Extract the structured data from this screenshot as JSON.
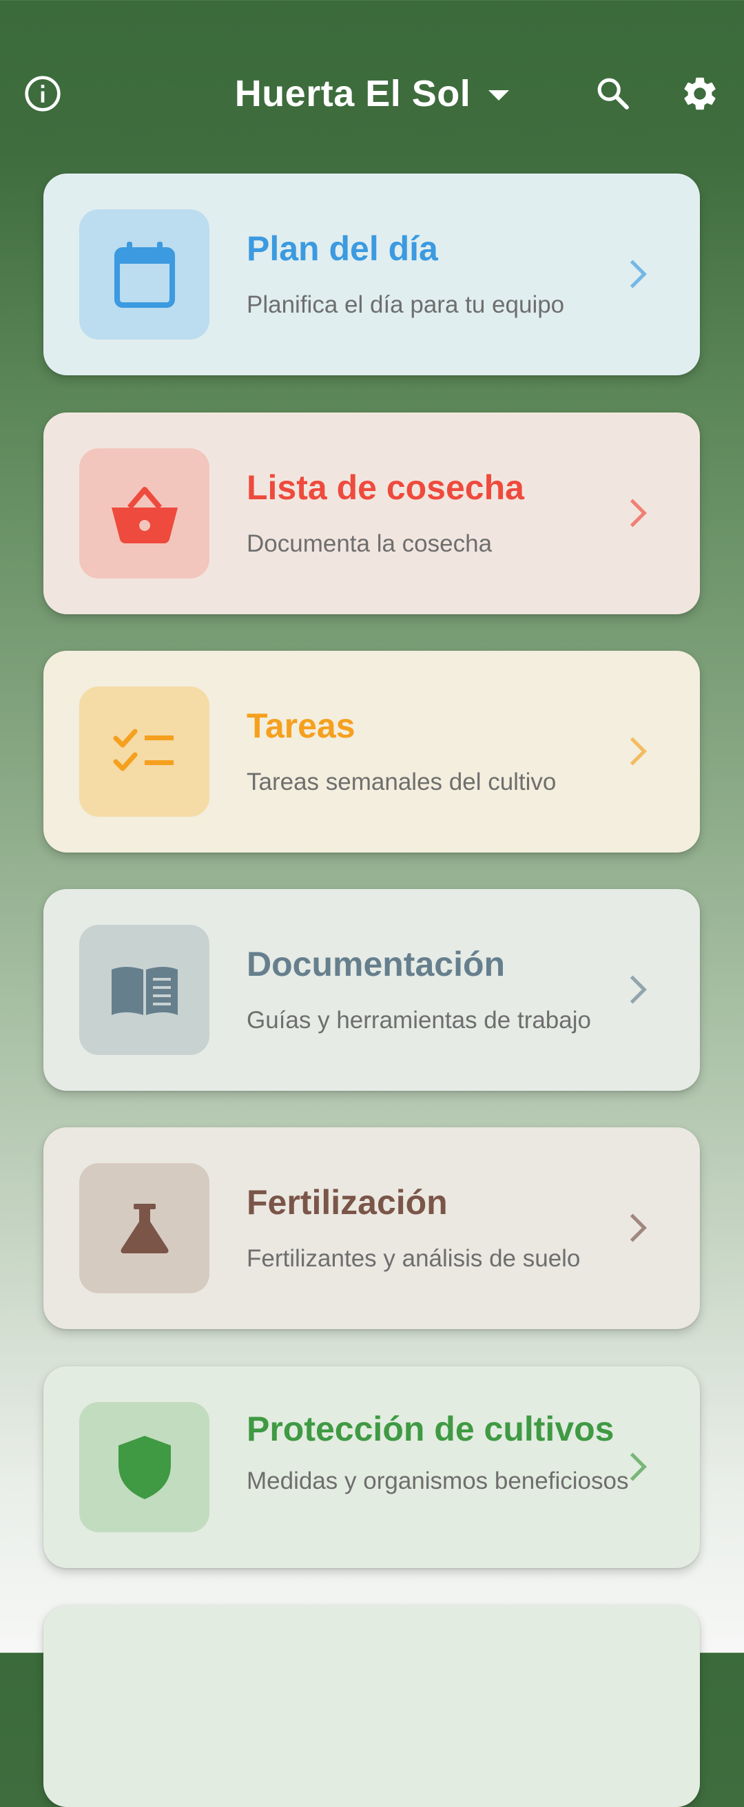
{
  "app": {
    "title": "Huerta El Sol",
    "icons": {
      "info": "info-circle-icon",
      "dropdown": "caret-down-icon",
      "search": "search-icon",
      "settings": "gear-icon"
    }
  },
  "cards": [
    {
      "title": "Plan del día",
      "subtitle": "Planifica el día para tu equipo",
      "icon": "calendar-icon",
      "accent": "#3b9ae0",
      "tile": "#bcdcef",
      "bg": "#e1eeef"
    },
    {
      "title": "Lista de cosecha",
      "subtitle": "Documenta la cosecha",
      "icon": "basket-icon",
      "accent": "#ee4a3d",
      "tile": "#f2c6bd",
      "bg": "#f1e6df"
    },
    {
      "title": "Tareas",
      "subtitle": "Tareas semanales del cultivo",
      "icon": "checklist-icon",
      "accent": "#f5a01e",
      "tile": "#f5dba6",
      "bg": "#f3eedd"
    },
    {
      "title": "Documentación",
      "subtitle": "Guías y herramientas de trabajo",
      "icon": "book-icon",
      "accent": "#667f8d",
      "tile": "#c8d2d1",
      "bg": "#e6ebe6"
    },
    {
      "title": "Fertilización",
      "subtitle": "Fertilizantes y análisis de suelo",
      "icon": "flask-icon",
      "accent": "#7a5548",
      "tile": "#d6cbc1",
      "bg": "#eae8e1"
    },
    {
      "title": "Protección de cultivos",
      "subtitle": "Medidas y organismos beneficiosos",
      "icon": "shield-icon",
      "accent": "#3f9a43",
      "tile": "#c2dcbf",
      "bg": "#e3ece0"
    }
  ]
}
